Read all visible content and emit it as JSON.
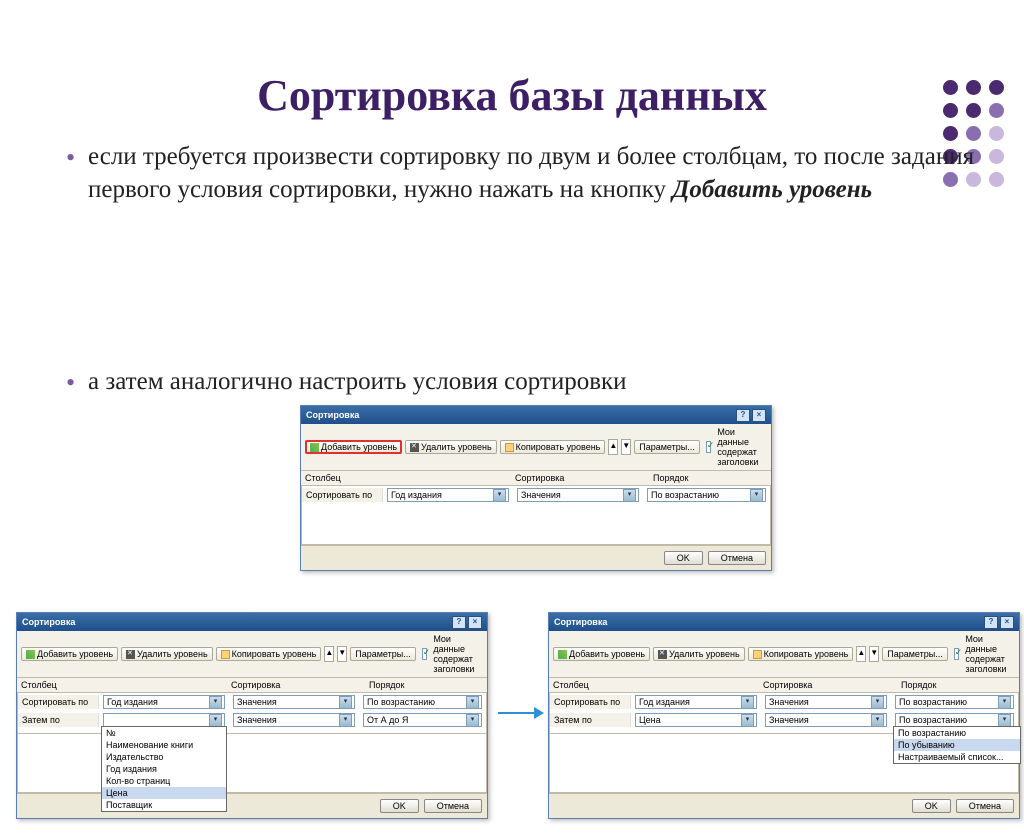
{
  "slide": {
    "title": "Сортировка базы данных",
    "bullet1_a": "если требуется произвести сортировку по двум и более столбцам, то после задания первого условия сортировки, нужно нажать на кнопку ",
    "bullet1_b": "Добавить уровень",
    "bullet2": "а затем аналогично настроить условия сортировки"
  },
  "dialog": {
    "title": "Сортировка",
    "btn_add": "Добавить уровень",
    "btn_del": "Удалить уровень",
    "btn_copy": "Копировать уровень",
    "btn_params": "Параметры...",
    "chk_headers": "Мои данные содержат заголовки",
    "hdr_col": "Столбец",
    "hdr_sort": "Сортировка",
    "hdr_order": "Порядок",
    "lbl_sortby": "Сортировать по",
    "lbl_thenby": "Затем по",
    "val_year": "Год издания",
    "val_price": "Цена",
    "val_values": "Значения",
    "val_asc": "По возрастанию",
    "val_az": "От А до Я",
    "val_desc": "По убыванию",
    "val_custom": "Настраиваемый список...",
    "dd_items": [
      "№",
      "Наименование книги",
      "Издательство",
      "Год издания",
      "Кол-во страниц",
      "Цена",
      "Поставщик"
    ],
    "ok": "OK",
    "cancel": "Отмена"
  }
}
